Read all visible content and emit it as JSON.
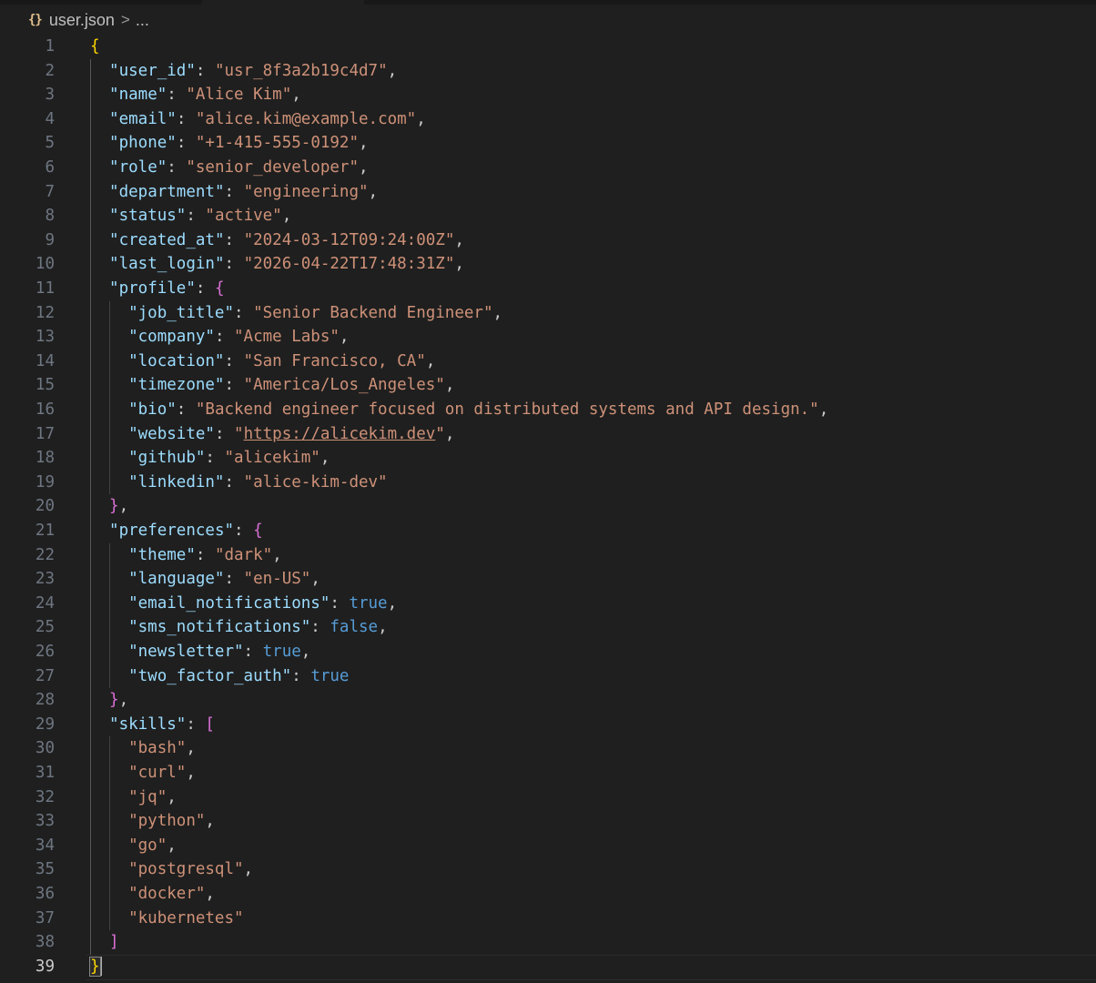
{
  "breadcrumb": {
    "icon": "{}",
    "filename": "user.json",
    "separator": ">",
    "more": "..."
  },
  "colors": {
    "background": "#1f1f1f",
    "key": "#9cdcfe",
    "string": "#ce9178",
    "boolean": "#569cd6",
    "bracket_level1": "#ffd700",
    "bracket_level2": "#da70d6",
    "line_number": "#6e7681"
  },
  "editor": {
    "active_line": 39,
    "lines": [
      {
        "n": "1",
        "tokens": [
          [
            "br1",
            "{"
          ]
        ]
      },
      {
        "n": "2",
        "tokens": [
          [
            "k",
            "\"user_id\""
          ],
          [
            "p",
            ": "
          ],
          [
            "s",
            "\"usr_8f3a2b19c4d7\""
          ],
          [
            "p",
            ","
          ]
        ]
      },
      {
        "n": "3",
        "tokens": [
          [
            "k",
            "\"name\""
          ],
          [
            "p",
            ": "
          ],
          [
            "s",
            "\"Alice Kim\""
          ],
          [
            "p",
            ","
          ]
        ]
      },
      {
        "n": "4",
        "tokens": [
          [
            "k",
            "\"email\""
          ],
          [
            "p",
            ": "
          ],
          [
            "s",
            "\"alice.kim@example.com\""
          ],
          [
            "p",
            ","
          ]
        ]
      },
      {
        "n": "5",
        "tokens": [
          [
            "k",
            "\"phone\""
          ],
          [
            "p",
            ": "
          ],
          [
            "s",
            "\"+1-415-555-0192\""
          ],
          [
            "p",
            ","
          ]
        ]
      },
      {
        "n": "6",
        "tokens": [
          [
            "k",
            "\"role\""
          ],
          [
            "p",
            ": "
          ],
          [
            "s",
            "\"senior_developer\""
          ],
          [
            "p",
            ","
          ]
        ]
      },
      {
        "n": "7",
        "tokens": [
          [
            "k",
            "\"department\""
          ],
          [
            "p",
            ": "
          ],
          [
            "s",
            "\"engineering\""
          ],
          [
            "p",
            ","
          ]
        ]
      },
      {
        "n": "8",
        "tokens": [
          [
            "k",
            "\"status\""
          ],
          [
            "p",
            ": "
          ],
          [
            "s",
            "\"active\""
          ],
          [
            "p",
            ","
          ]
        ]
      },
      {
        "n": "9",
        "tokens": [
          [
            "k",
            "\"created_at\""
          ],
          [
            "p",
            ": "
          ],
          [
            "s",
            "\"2024-03-12T09:24:00Z\""
          ],
          [
            "p",
            ","
          ]
        ]
      },
      {
        "n": "10",
        "tokens": [
          [
            "k",
            "\"last_login\""
          ],
          [
            "p",
            ": "
          ],
          [
            "s",
            "\"2026-04-22T17:48:31Z\""
          ],
          [
            "p",
            ","
          ]
        ]
      },
      {
        "n": "11",
        "tokens": [
          [
            "k",
            "\"profile\""
          ],
          [
            "p",
            ": "
          ],
          [
            "br2",
            "{"
          ]
        ]
      },
      {
        "n": "12",
        "tokens": [
          [
            "k",
            "\"job_title\""
          ],
          [
            "p",
            ": "
          ],
          [
            "s",
            "\"Senior Backend Engineer\""
          ],
          [
            "p",
            ","
          ]
        ]
      },
      {
        "n": "13",
        "tokens": [
          [
            "k",
            "\"company\""
          ],
          [
            "p",
            ": "
          ],
          [
            "s",
            "\"Acme Labs\""
          ],
          [
            "p",
            ","
          ]
        ]
      },
      {
        "n": "14",
        "tokens": [
          [
            "k",
            "\"location\""
          ],
          [
            "p",
            ": "
          ],
          [
            "s",
            "\"San Francisco, CA\""
          ],
          [
            "p",
            ","
          ]
        ]
      },
      {
        "n": "15",
        "tokens": [
          [
            "k",
            "\"timezone\""
          ],
          [
            "p",
            ": "
          ],
          [
            "s",
            "\"America/Los_Angeles\""
          ],
          [
            "p",
            ","
          ]
        ]
      },
      {
        "n": "16",
        "tokens": [
          [
            "k",
            "\"bio\""
          ],
          [
            "p",
            ": "
          ],
          [
            "s",
            "\"Backend engineer focused on distributed systems and API design.\""
          ],
          [
            "p",
            ","
          ]
        ]
      },
      {
        "n": "17",
        "tokens": [
          [
            "k",
            "\"website\""
          ],
          [
            "p",
            ": "
          ],
          [
            "s",
            "\""
          ],
          [
            "su",
            "https://alicekim.dev"
          ],
          [
            "s",
            "\""
          ],
          [
            "p",
            ","
          ]
        ]
      },
      {
        "n": "18",
        "tokens": [
          [
            "k",
            "\"github\""
          ],
          [
            "p",
            ": "
          ],
          [
            "s",
            "\"alicekim\""
          ],
          [
            "p",
            ","
          ]
        ]
      },
      {
        "n": "19",
        "tokens": [
          [
            "k",
            "\"linkedin\""
          ],
          [
            "p",
            ": "
          ],
          [
            "s",
            "\"alice-kim-dev\""
          ]
        ]
      },
      {
        "n": "20",
        "tokens": [
          [
            "br2",
            "}"
          ],
          [
            "p",
            ","
          ]
        ]
      },
      {
        "n": "21",
        "tokens": [
          [
            "k",
            "\"preferences\""
          ],
          [
            "p",
            ": "
          ],
          [
            "br2",
            "{"
          ]
        ]
      },
      {
        "n": "22",
        "tokens": [
          [
            "k",
            "\"theme\""
          ],
          [
            "p",
            ": "
          ],
          [
            "s",
            "\"dark\""
          ],
          [
            "p",
            ","
          ]
        ]
      },
      {
        "n": "23",
        "tokens": [
          [
            "k",
            "\"language\""
          ],
          [
            "p",
            ": "
          ],
          [
            "s",
            "\"en-US\""
          ],
          [
            "p",
            ","
          ]
        ]
      },
      {
        "n": "24",
        "tokens": [
          [
            "k",
            "\"email_notifications\""
          ],
          [
            "p",
            ": "
          ],
          [
            "b",
            "true"
          ],
          [
            "p",
            ","
          ]
        ]
      },
      {
        "n": "25",
        "tokens": [
          [
            "k",
            "\"sms_notifications\""
          ],
          [
            "p",
            ": "
          ],
          [
            "b",
            "false"
          ],
          [
            "p",
            ","
          ]
        ]
      },
      {
        "n": "26",
        "tokens": [
          [
            "k",
            "\"newsletter\""
          ],
          [
            "p",
            ": "
          ],
          [
            "b",
            "true"
          ],
          [
            "p",
            ","
          ]
        ]
      },
      {
        "n": "27",
        "tokens": [
          [
            "k",
            "\"two_factor_auth\""
          ],
          [
            "p",
            ": "
          ],
          [
            "b",
            "true"
          ]
        ]
      },
      {
        "n": "28",
        "tokens": [
          [
            "br2",
            "}"
          ],
          [
            "p",
            ","
          ]
        ]
      },
      {
        "n": "29",
        "tokens": [
          [
            "k",
            "\"skills\""
          ],
          [
            "p",
            ": "
          ],
          [
            "br2",
            "["
          ]
        ]
      },
      {
        "n": "30",
        "tokens": [
          [
            "s",
            "\"bash\""
          ],
          [
            "p",
            ","
          ]
        ]
      },
      {
        "n": "31",
        "tokens": [
          [
            "s",
            "\"curl\""
          ],
          [
            "p",
            ","
          ]
        ]
      },
      {
        "n": "32",
        "tokens": [
          [
            "s",
            "\"jq\""
          ],
          [
            "p",
            ","
          ]
        ]
      },
      {
        "n": "33",
        "tokens": [
          [
            "s",
            "\"python\""
          ],
          [
            "p",
            ","
          ]
        ]
      },
      {
        "n": "34",
        "tokens": [
          [
            "s",
            "\"go\""
          ],
          [
            "p",
            ","
          ]
        ]
      },
      {
        "n": "35",
        "tokens": [
          [
            "s",
            "\"postgresql\""
          ],
          [
            "p",
            ","
          ]
        ]
      },
      {
        "n": "36",
        "tokens": [
          [
            "s",
            "\"docker\""
          ],
          [
            "p",
            ","
          ]
        ]
      },
      {
        "n": "37",
        "tokens": [
          [
            "s",
            "\"kubernetes\""
          ]
        ]
      },
      {
        "n": "38",
        "tokens": [
          [
            "br2",
            "]"
          ]
        ]
      },
      {
        "n": "39",
        "tokens": [
          [
            "br1bm",
            "}"
          ]
        ]
      }
    ]
  }
}
